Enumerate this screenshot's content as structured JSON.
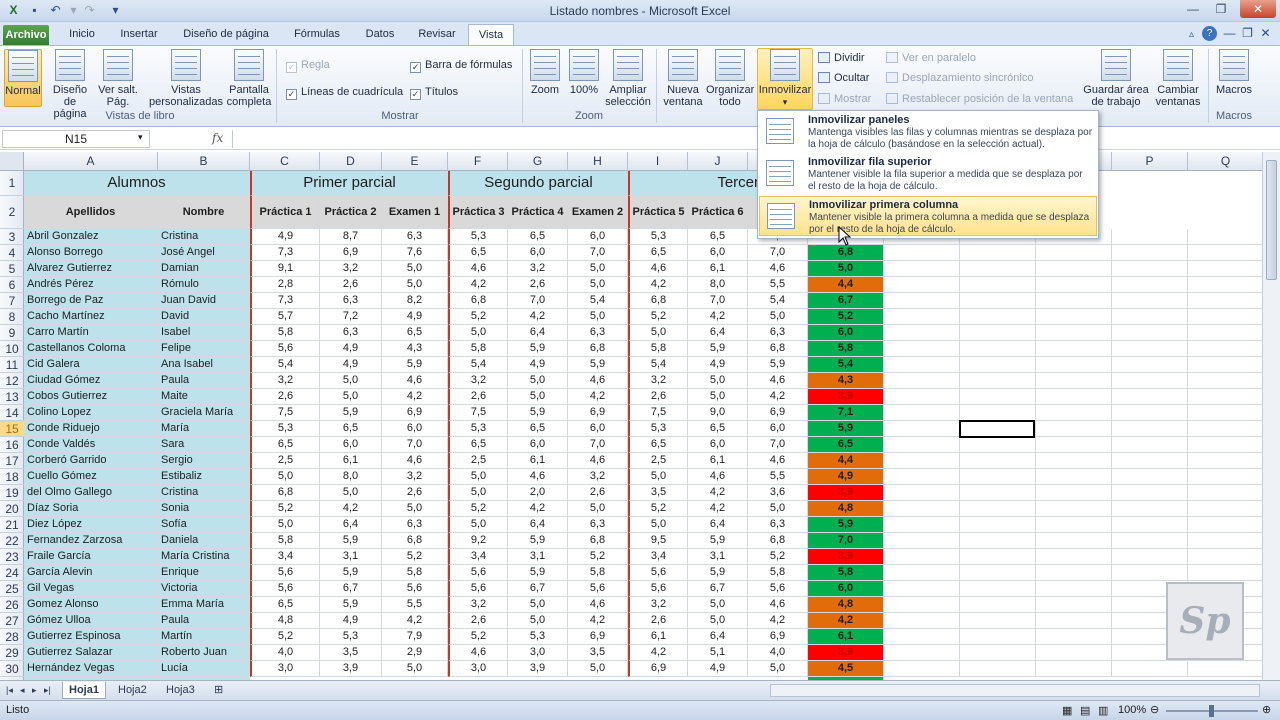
{
  "window": {
    "title": "Listado nombres - Microsoft Excel"
  },
  "tabs": [
    "Archivo",
    "Inicio",
    "Insertar",
    "Diseño de página",
    "Fórmulas",
    "Datos",
    "Revisar",
    "Vista"
  ],
  "ribbon": {
    "normal": "Normal",
    "diseno": "Diseño de página",
    "versalt": "Ver salt. Pág.",
    "vistas": "Vistas personalizadas",
    "pantalla": "Pantalla completa",
    "grp_vistas": "Vistas de libro",
    "regla": "Regla",
    "lineas": "Líneas de cuadrícula",
    "barra": "Barra de fórmulas",
    "titulos": "Títulos",
    "grp_mostrar": "Mostrar",
    "zoom": "Zoom",
    "zoom100": "100%",
    "ampliar": "Ampliar selección",
    "grp_zoom": "Zoom",
    "nueva": "Nueva ventana",
    "organizar": "Organizar todo",
    "inmovilizar": "Inmovilizar",
    "dividir": "Dividir",
    "ocultar": "Ocultar",
    "mostrar": "Mostrar",
    "paralelo": "Ver en paralelo",
    "sincronico": "Desplazamiento sincrónico",
    "restablecer": "Restablecer posición de la ventana",
    "guardar": "Guardar área de trabajo",
    "cambiar": "Cambiar ventanas",
    "macros": "Macros",
    "grp_macros": "Macros"
  },
  "namebox": "N15",
  "fx": "fx",
  "menu": [
    {
      "title": "Inmovilizar paneles",
      "desc": "Mantenga visibles las filas y columnas mientras se desplaza por la hoja de cálculo (basándose en la selección actual)."
    },
    {
      "title": "Inmovilizar fila superior",
      "desc": "Mantener visible la fila superior a medida que se desplaza por el resto de la hoja de cálculo."
    },
    {
      "title": "Inmovilizar primera columna",
      "desc": "Mantener visible la primera columna a medida que se desplaza por el resto de la hoja de cálculo."
    }
  ],
  "columns": [
    "A",
    "B",
    "C",
    "D",
    "E",
    "F",
    "G",
    "H",
    "I",
    "J",
    "K",
    "L",
    "M",
    "N",
    "O",
    "P",
    "Q"
  ],
  "headers": {
    "alumnos": "Alumnos",
    "p1": "Primer parcial",
    "p2": "Segundo parcial",
    "p3": "Tercer parci"
  },
  "subheaders": [
    "Apellidos",
    "Nombre",
    "Práctica 1",
    "Práctica 2",
    "Examen 1",
    "Práctica 3",
    "Práctica 4",
    "Examen 2",
    "Práctica 5",
    "Práctica 6",
    "E"
  ],
  "rows": [
    [
      "Abril Gonzalez",
      "Cristina",
      "4,9",
      "8,7",
      "6,3",
      "5,3",
      "6,5",
      "6,0",
      "5,3",
      "6,5",
      "6,0",
      ""
    ],
    [
      "Alonso Borrego",
      "José Angel",
      "7,3",
      "6,9",
      "7,6",
      "6,5",
      "6,0",
      "7,0",
      "6,5",
      "6,0",
      "7,0",
      "6,8"
    ],
    [
      "Alvarez Gutierrez",
      "Damian",
      "9,1",
      "3,2",
      "5,0",
      "4,6",
      "3,2",
      "5,0",
      "4,6",
      "6,1",
      "4,6",
      "5,0"
    ],
    [
      "Andrés Pérez",
      "Rómulo",
      "2,8",
      "2,6",
      "5,0",
      "4,2",
      "2,6",
      "5,0",
      "4,2",
      "8,0",
      "5,5",
      "4,4"
    ],
    [
      "Borrego de Paz",
      "Juan David",
      "7,3",
      "6,3",
      "8,2",
      "6,8",
      "7,0",
      "5,4",
      "6,8",
      "7,0",
      "5,4",
      "6,7"
    ],
    [
      "Cacho Martínez",
      "David",
      "5,7",
      "7,2",
      "4,9",
      "5,2",
      "4,2",
      "5,0",
      "5,2",
      "4,2",
      "5,0",
      "5,2"
    ],
    [
      "Carro Martín",
      "Isabel",
      "5,8",
      "6,3",
      "6,5",
      "5,0",
      "6,4",
      "6,3",
      "5,0",
      "6,4",
      "6,3",
      "6,0"
    ],
    [
      "Castellanos Coloma",
      "Felipe",
      "5,6",
      "4,9",
      "4,3",
      "5,8",
      "5,9",
      "6,8",
      "5,8",
      "5,9",
      "6,8",
      "5,8"
    ],
    [
      "Cid Galera",
      "Ana Isabel",
      "5,4",
      "4,9",
      "5,9",
      "5,4",
      "4,9",
      "5,9",
      "5,4",
      "4,9",
      "5,9",
      "5,4"
    ],
    [
      "Ciudad Gómez",
      "Paula",
      "3,2",
      "5,0",
      "4,6",
      "3,2",
      "5,0",
      "4,6",
      "3,2",
      "5,0",
      "4,6",
      "4,3"
    ],
    [
      "Cobos Gutierrez",
      "Maite",
      "2,6",
      "5,0",
      "4,2",
      "2,6",
      "5,0",
      "4,2",
      "2,6",
      "5,0",
      "4,2",
      "3,9"
    ],
    [
      "Colino Lopez",
      "Graciela María",
      "7,5",
      "5,9",
      "6,9",
      "7,5",
      "5,9",
      "6,9",
      "7,5",
      "9,0",
      "6,9",
      "7,1"
    ],
    [
      "Conde Riduejo",
      "María",
      "5,3",
      "6,5",
      "6,0",
      "5,3",
      "6,5",
      "6,0",
      "5,3",
      "6,5",
      "6,0",
      "5,9"
    ],
    [
      "Conde Valdés",
      "Sara",
      "6,5",
      "6,0",
      "7,0",
      "6,5",
      "6,0",
      "7,0",
      "6,5",
      "6,0",
      "7,0",
      "6,5"
    ],
    [
      "Corberó Garrido",
      "Sergio",
      "2,5",
      "6,1",
      "4,6",
      "2,5",
      "6,1",
      "4,6",
      "2,5",
      "6,1",
      "4,6",
      "4,4"
    ],
    [
      "Cuello Gómez",
      "Estibaliz",
      "5,0",
      "8,0",
      "3,2",
      "5,0",
      "4,6",
      "3,2",
      "5,0",
      "4,6",
      "5,5",
      "4,9"
    ],
    [
      "del Olmo Gallego",
      "Cristina",
      "6,8",
      "5,0",
      "2,6",
      "5,0",
      "2,0",
      "2,6",
      "3,5",
      "4,2",
      "3,6",
      "3,9"
    ],
    [
      "Díaz Soria",
      "Sonia",
      "5,2",
      "4,2",
      "5,0",
      "5,2",
      "4,2",
      "5,0",
      "5,2",
      "4,2",
      "5,0",
      "4,8"
    ],
    [
      "Diez López",
      "Sofía",
      "5,0",
      "6,4",
      "6,3",
      "5,0",
      "6,4",
      "6,3",
      "5,0",
      "6,4",
      "6,3",
      "5,9"
    ],
    [
      "Fernandez Zarzosa",
      "Daniela",
      "5,8",
      "5,9",
      "6,8",
      "9,2",
      "5,9",
      "6,8",
      "9,5",
      "5,9",
      "6,8",
      "7,0"
    ],
    [
      "Fraile García",
      "María Cristina",
      "3,4",
      "3,1",
      "5,2",
      "3,4",
      "3,1",
      "5,2",
      "3,4",
      "3,1",
      "5,2",
      "3,9"
    ],
    [
      "García Alevin",
      "Enrique",
      "5,6",
      "5,9",
      "5,8",
      "5,6",
      "5,9",
      "5,8",
      "5,6",
      "5,9",
      "5,8",
      "5,8"
    ],
    [
      "Gil Vegas",
      "Victoria",
      "5,6",
      "6,7",
      "5,6",
      "5,6",
      "6,7",
      "5,6",
      "5,6",
      "6,7",
      "5,6",
      "6,0"
    ],
    [
      "Gomez Alonso",
      "Emma María",
      "6,5",
      "5,9",
      "5,5",
      "3,2",
      "5,0",
      "4,6",
      "3,2",
      "5,0",
      "4,6",
      "4,8"
    ],
    [
      "Gómez Ulloa",
      "Paula",
      "4,8",
      "4,9",
      "4,2",
      "2,6",
      "5,0",
      "4,2",
      "2,6",
      "5,0",
      "4,2",
      "4,2"
    ],
    [
      "Gutierrez Espinosa",
      "Martín",
      "5,2",
      "5,3",
      "7,9",
      "5,2",
      "5,3",
      "6,9",
      "6,1",
      "6,4",
      "6,9",
      "6,1"
    ],
    [
      "Gutierrez Salazar",
      "Roberto Juan",
      "4,0",
      "3,5",
      "2,9",
      "4,6",
      "3,0",
      "3,5",
      "4,2",
      "5,1",
      "4,0",
      "3,9"
    ],
    [
      "Hernández Vegas",
      "Lucía",
      "3,0",
      "3,9",
      "5,0",
      "3,0",
      "3,9",
      "5,0",
      "6,9",
      "4,9",
      "5,0",
      "4,5"
    ]
  ],
  "sheets": [
    "Hoja1",
    "Hoja2",
    "Hoja3"
  ],
  "status": {
    "ready": "Listo",
    "zoom": "100%"
  },
  "logo": "Sp",
  "colors": {
    "names_bg": "#bde2ec",
    "pass": "#00b050",
    "warn": "#e26b0a",
    "fail": "#ff0000"
  }
}
